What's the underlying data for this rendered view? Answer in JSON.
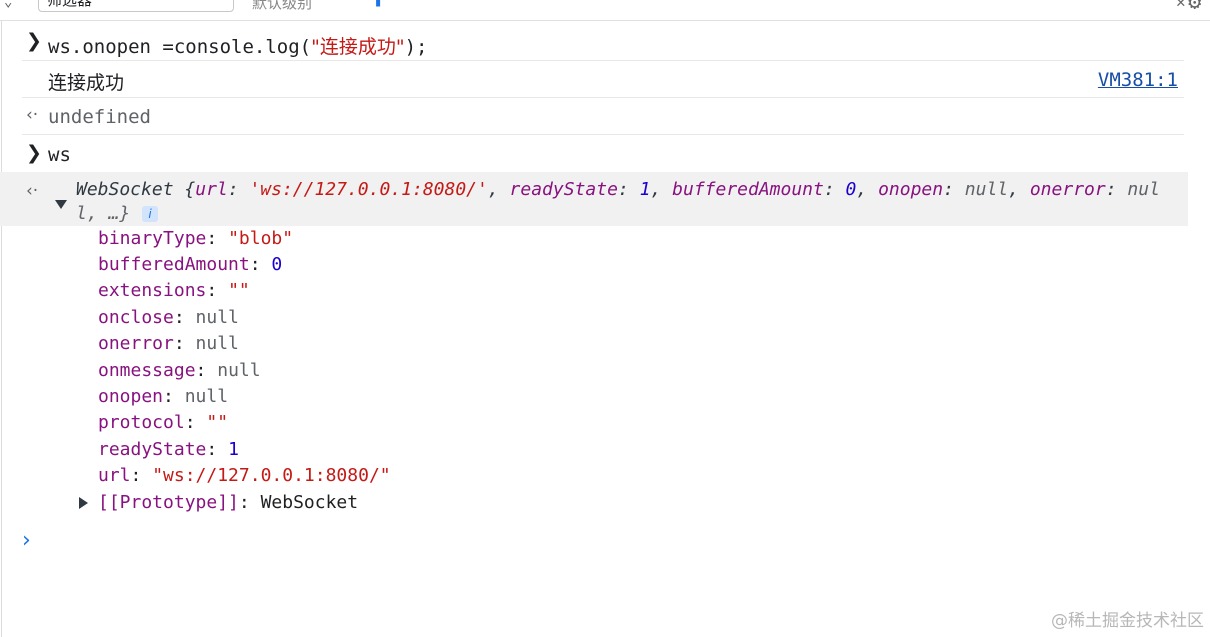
{
  "toolbar": {
    "filter_value": "筛选器",
    "levels_label": "默认级别"
  },
  "console": {
    "entries": [
      {
        "type": "input",
        "code_prefix": "ws.onopen =console.log(",
        "code_string": "\"连接成功\"",
        "code_suffix": ");"
      },
      {
        "type": "log",
        "text": "连接成功",
        "source": "VM381:1"
      },
      {
        "type": "result",
        "text": "undefined"
      },
      {
        "type": "input",
        "code": "ws"
      }
    ],
    "object": {
      "class_name": "WebSocket",
      "preview_line1": {
        "open": " {",
        "k1": "url",
        "v1": "'ws://127.0.0.1:8080/'",
        "k2": "readyState",
        "v2": "1",
        "k3": "bufferedAmount",
        "v3": "0",
        "k4": "onopen",
        "v4": "null",
        "k5": "onerror",
        "v5": "nul"
      },
      "preview_line2": "l, …}",
      "info_badge": "i",
      "properties": [
        {
          "key": "binaryType",
          "value": "\"blob\"",
          "kind": "str"
        },
        {
          "key": "bufferedAmount",
          "value": "0",
          "kind": "num"
        },
        {
          "key": "extensions",
          "value": "\"\"",
          "kind": "str"
        },
        {
          "key": "onclose",
          "value": "null",
          "kind": "null"
        },
        {
          "key": "onerror",
          "value": "null",
          "kind": "null"
        },
        {
          "key": "onmessage",
          "value": "null",
          "kind": "null"
        },
        {
          "key": "onopen",
          "value": "null",
          "kind": "null"
        },
        {
          "key": "protocol",
          "value": "\"\"",
          "kind": "str"
        },
        {
          "key": "readyState",
          "value": "1",
          "kind": "num"
        },
        {
          "key": "url",
          "value": "\"ws://127.0.0.1:8080/\"",
          "kind": "str"
        }
      ],
      "prototype": {
        "key": "[[Prototype]]",
        "value": "WebSocket"
      }
    }
  },
  "watermark": "@稀土掘金技术社区",
  "colors": {
    "key": "#881280",
    "string": "#c41a16",
    "number": "#1c00cf",
    "null": "#5f6368",
    "link": "#174ea6",
    "prompt": "#1a73e8"
  },
  "icons": [
    "chevron-right-icon",
    "return-arrow-icon",
    "triangle-down-icon",
    "triangle-right-icon",
    "info-icon",
    "gear-icon",
    "close-icon"
  ]
}
